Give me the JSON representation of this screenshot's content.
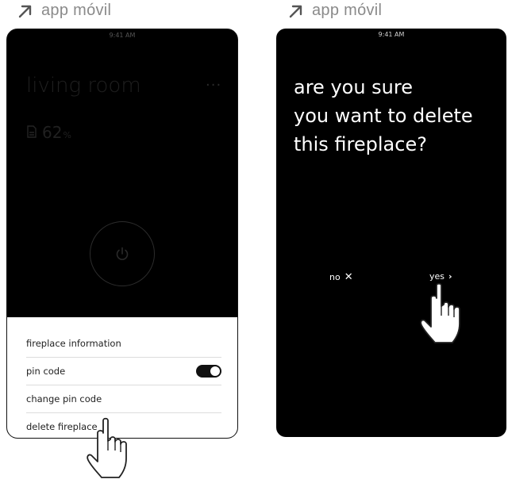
{
  "labels": {
    "left": "app móvil",
    "right": "app móvil"
  },
  "left_screen": {
    "status_time": "9:41 AM",
    "room_title": "living room",
    "more_icon": "more-icon",
    "battery": {
      "value": "62",
      "unit": "%"
    },
    "menu": {
      "items": [
        {
          "label": "fireplace information"
        },
        {
          "label": "pin code",
          "toggle_on": true
        },
        {
          "label": "change pin code"
        },
        {
          "label": "delete fireplace"
        }
      ]
    }
  },
  "right_screen": {
    "status_time": "9:41 AM",
    "question_lines": [
      "are you sure",
      "you want to delete",
      "this fireplace?"
    ],
    "no_label": "no",
    "yes_label": "yes"
  },
  "colors": {
    "screen_bg": "#000000",
    "label_gray": "#8a8a8a",
    "sheet_bg": "#ffffff"
  }
}
